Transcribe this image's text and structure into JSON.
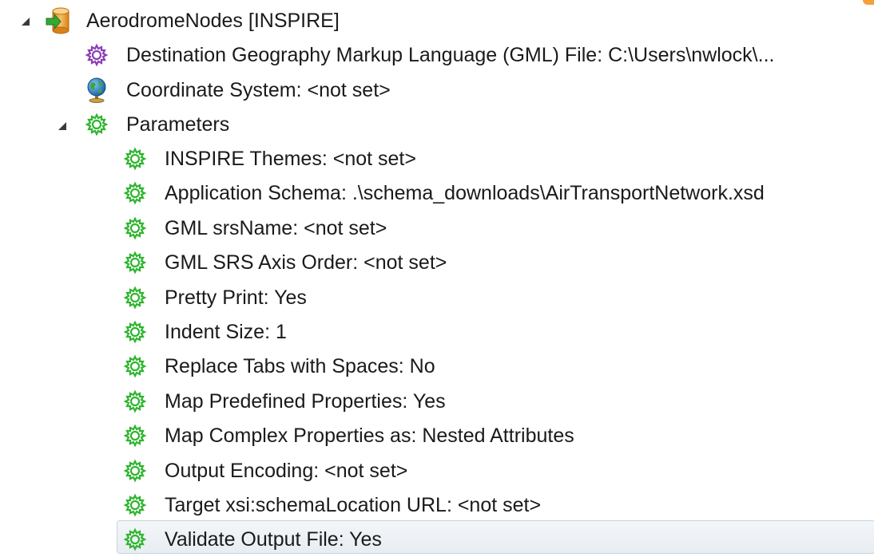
{
  "colors": {
    "text": "#1a1a1a",
    "gear_green": "#2fb52f",
    "gear_purple": "#8b3fb5",
    "db_orange": "#f0a030",
    "arrow_green": "#2aa02a",
    "selection_border": "#c9d3dd"
  },
  "tree": {
    "root": {
      "label": "AerodromeNodes [INSPIRE]",
      "icon": "database-writer-icon",
      "expanded": true,
      "children": {
        "destination": {
          "label": "Destination Geography Markup Language (GML) File: C:\\Users\\nwlock\\...",
          "icon": "purple-gear-icon"
        },
        "coordinate": {
          "label": "Coordinate System: <not set>",
          "icon": "globe-icon"
        },
        "parameters": {
          "label": "Parameters",
          "icon": "green-gear-icon",
          "expanded": true,
          "items": [
            {
              "label": "INSPIRE Themes: <not set>"
            },
            {
              "label": "Application Schema: .\\schema_downloads\\AirTransportNetwork.xsd"
            },
            {
              "label": "GML srsName: <not set>"
            },
            {
              "label": "GML SRS Axis Order: <not set>"
            },
            {
              "label": "Pretty Print: Yes"
            },
            {
              "label": "Indent Size: 1"
            },
            {
              "label": "Replace Tabs with Spaces: No"
            },
            {
              "label": "Map Predefined Properties: Yes"
            },
            {
              "label": "Map Complex Properties as: Nested Attributes"
            },
            {
              "label": "Output Encoding: <not set>"
            },
            {
              "label": "Target xsi:schemaLocation URL: <not set>"
            },
            {
              "label": "Validate Output File: Yes",
              "selected": true
            }
          ]
        }
      }
    }
  }
}
